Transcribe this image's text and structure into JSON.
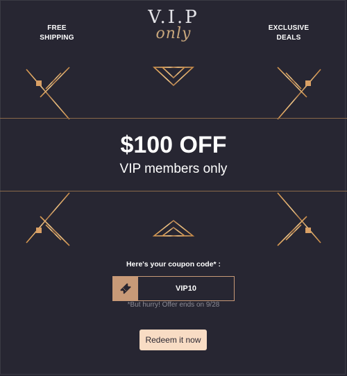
{
  "header": {
    "left_line1": "FREE",
    "left_line2": "SHIPPING",
    "right_line1": "EXCLUSIVE",
    "right_line2": "DEALS",
    "logo_main": "V.I.P",
    "logo_script": "only"
  },
  "hero": {
    "title": "$100 OFF",
    "subtitle": "VIP members only"
  },
  "coupon": {
    "label": "Here's your coupon code* :",
    "code": "VIP10",
    "icon": "ticket-icon",
    "note": "*But hurry! Offer ends on 9/28"
  },
  "cta": {
    "label": "Redeem it now"
  },
  "colors": {
    "background": "#272632",
    "gold": "#c9a77c",
    "coupon_accent": "#c89a78",
    "button_bg": "#f8dcc4"
  }
}
